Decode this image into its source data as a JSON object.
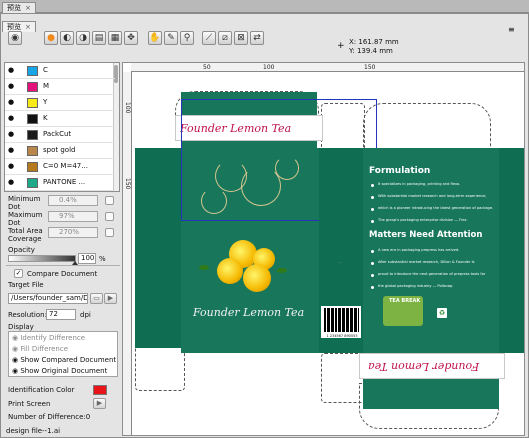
{
  "tabs": [
    {
      "label": "预览",
      "close": "×"
    },
    {
      "label": "预览",
      "close": "×"
    }
  ],
  "coordinates": {
    "x_label": "X:",
    "x_value": "161.87 mm",
    "y_label": "Y:",
    "y_value": "139.4 mm"
  },
  "toolbar": {
    "icons": [
      "eye-icon",
      "color-circle-icon",
      "half-circle-icon",
      "half-circle-alt-icon",
      "split-view-icon",
      "grid-icon",
      "hand-icon",
      "pan-icon",
      "eyedropper-icon",
      "magnifier-icon",
      "measure-icon",
      "ruler-icon",
      "crossed-box-icon",
      "compare-icon"
    ]
  },
  "separations": [
    {
      "label": "C",
      "color": "#19a4e6"
    },
    {
      "label": "M",
      "color": "#e5127c"
    },
    {
      "label": "Y",
      "color": "#f7ea1a"
    },
    {
      "label": "K",
      "color": "#111111"
    },
    {
      "label": "PackCut",
      "color": "#1a1a1a"
    },
    {
      "label": "spot gold",
      "color": "#b9874a"
    },
    {
      "label": "C=0 M=47...",
      "color": "#b57a1e"
    },
    {
      "label": "PANTONE ...",
      "color": "#1da98a"
    }
  ],
  "settings": {
    "min_dot_label": "Minimum Dot",
    "min_dot_value": "0.4%",
    "max_dot_label": "Maximum Dot",
    "max_dot_value": "97%",
    "tac_label": "Total Area Coverage",
    "tac_value": "270%",
    "opacity_label": "Opacity",
    "opacity_value": "100",
    "opacity_unit": "%",
    "opacity": 1.0
  },
  "compare": {
    "checkbox_label": "Compare Document",
    "target_label": "Target File",
    "target_path": "/Users/founder_sam/De",
    "resolution_label": "Resolution:",
    "resolution_value": "72",
    "resolution_unit": "dpi",
    "display_label": "Display",
    "display_options": [
      {
        "label": "Identify Difference",
        "enabled": false
      },
      {
        "label": "Fill Difference",
        "enabled": false
      },
      {
        "label": "Show Compared Document",
        "enabled": true
      },
      {
        "label": "Show Original Document",
        "enabled": true
      }
    ],
    "id_color_label": "Identification Color",
    "id_color": "#e8141a",
    "print_screen_label": "Print Screen",
    "num_diff_label": "Number of Difference:",
    "num_diff_value": "0"
  },
  "status": {
    "filename": "design file--1.ai"
  },
  "ruler": {
    "h_ticks": [
      "50",
      "100",
      "150"
    ],
    "v_ticks": [
      "100",
      "150"
    ]
  },
  "package": {
    "brand": "Founder Lemon Tea",
    "formulation_title": "Formulation",
    "formulation_items": [
      "It specializes in packaging, printing and flexo.",
      "With substantial market research and long-term experience,",
      "which is a pioneer introducing the latest generation of package.",
      "The group's packaging enterprise division — Flex."
    ],
    "attention_title": "Matters Need Attention",
    "attention_items": [
      "A new era in packaging prepress has arrived.",
      "After substantial market research, Dillon & Founder is",
      "proud to introduce the next generation of prepress tools for",
      "the global packaging industry — Pollsnap."
    ],
    "teabreak": "TEA BREAK",
    "barcode_number": "1 234567 890555"
  }
}
